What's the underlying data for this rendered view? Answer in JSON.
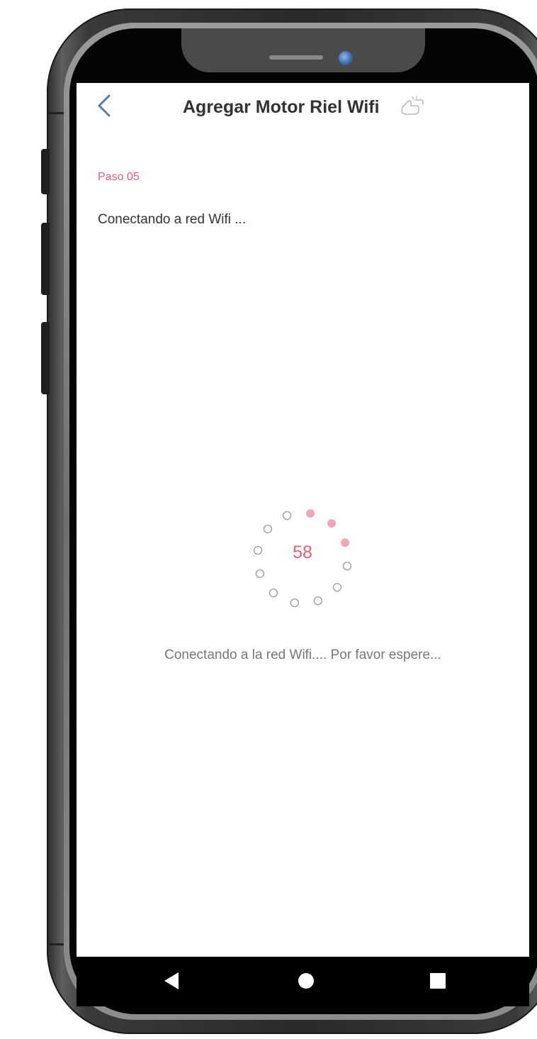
{
  "header": {
    "title": "Agregar Motor Riel Wifi",
    "back_icon": "chevron-left-icon",
    "title_icon": "hand-tap-icon"
  },
  "step": {
    "label": "Paso 05",
    "description": "Conectando a red Wifi ..."
  },
  "progress": {
    "countdown": "58",
    "active_dots": 3,
    "total_dots": 12,
    "message": "Conectando a la red Wifi.... Por favor espere..."
  },
  "nav": {
    "back_icon": "triangle-back-icon",
    "home_icon": "circle-home-icon",
    "recents_icon": "square-recents-icon"
  },
  "colors": {
    "accent": "#e0607a",
    "accent_light": "#f2a7b6",
    "text_primary": "#333333",
    "text_secondary": "#777777",
    "back_chevron": "#5b7aa8"
  }
}
